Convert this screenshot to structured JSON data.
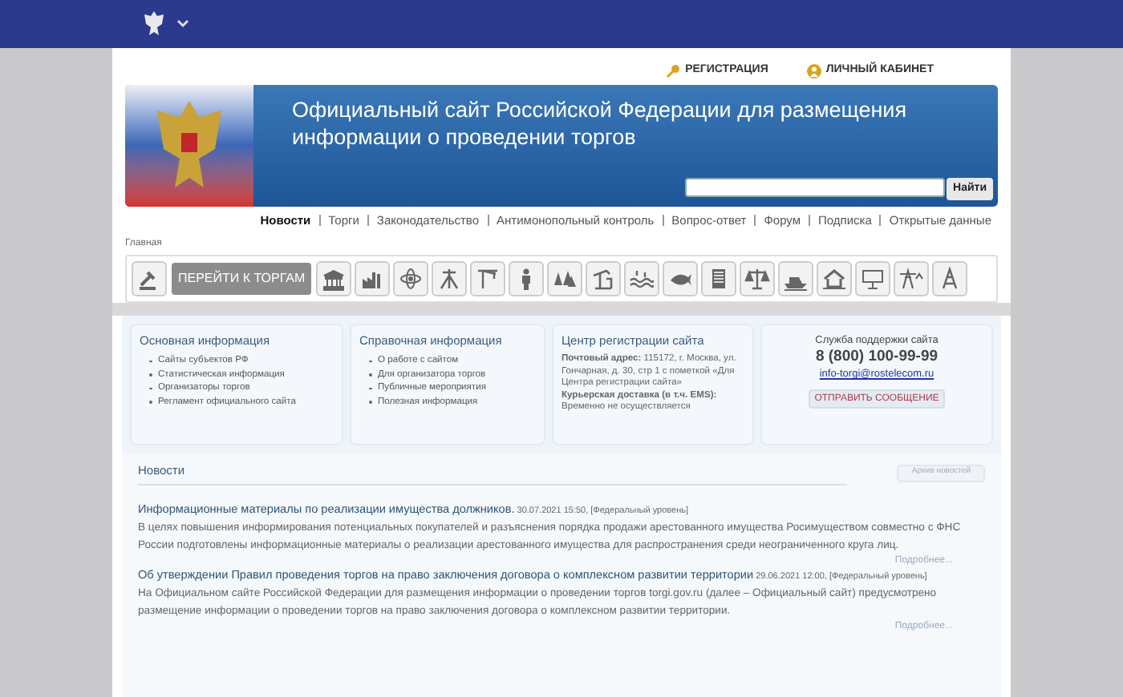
{
  "top_links": [
    {
      "label": "РЕГИСТРАЦИЯ",
      "kind": "key"
    },
    {
      "label": "ЛИЧНЫЙ КАБИНЕТ",
      "kind": "person"
    }
  ],
  "banner": {
    "title": "Официальный сайт Российской Федерации для размещения информации о проведении торгов",
    "search_button": "Найти"
  },
  "nav": [
    {
      "label": "Новости",
      "selected": true
    },
    {
      "label": "Торги",
      "selected": false
    },
    {
      "label": "Законодательство",
      "selected": false
    },
    {
      "label": "Антимонопольный контроль",
      "selected": false
    },
    {
      "label": "Вопрос-ответ",
      "selected": false
    },
    {
      "label": "Форум",
      "selected": false
    },
    {
      "label": "Подписка",
      "selected": false
    },
    {
      "label": "Открытые данные",
      "selected": false
    }
  ],
  "breadcrumb": "Главная",
  "go_button": "ПЕРЕЙТИ К ТОРГАМ",
  "panels": [
    {
      "kind": "list",
      "title": "Основная информация",
      "items": [
        "Сайты субъектов РФ",
        "Статистическая информация",
        "Организаторы торгов",
        "Регламент официального сайта"
      ]
    },
    {
      "kind": "list",
      "title": "Справочная информация",
      "items": [
        "О работе с сайтом",
        "Для организатора торгов",
        "Публичные мероприятия",
        "Полезная информация"
      ]
    },
    {
      "kind": "address",
      "title": "Центр регистрации сайта",
      "lines": [
        {
          "label": "Почтовый адрес:",
          "text": " 115172, г. Москва, ул. Гончарная, д. 30, стр 1 с пометкой «Для Центра регистрации сайта»"
        },
        {
          "label": "Курьерская доставка (в т.ч. EMS):",
          "text": " Временно не осуществляется"
        }
      ]
    },
    {
      "kind": "support",
      "title": "Служба поддержки сайта",
      "phone": "8 (800) 100-99-99",
      "email": "info-torgi@rostelecom.ru",
      "button": "ОТПРАВИТЬ СООБЩЕНИЕ"
    }
  ],
  "news": {
    "title": "Новости",
    "archive_button": "Архив новостей",
    "items": [
      {
        "headline": "Информационные материалы по реализации имущества должников.",
        "meta": "30.07.2021 15:50, [Федеральный уровень]",
        "body": "В целях повышения информирования потенциальных покупателей и разъяснения порядка продажи арестованного имущества Росимуществом совместно с ФНС России подготовлены информационные материалы о реализации арестованного имущества для распространения среди неограниченного круга лиц.",
        "more": "Подробнее..."
      },
      {
        "headline": "Об утверждении Правил проведения торгов на право заключения договора о комплексном развитии территории",
        "meta": "29.06.2021 12:00, [Федеральный уровень]",
        "body": "На Официальном сайте Российской Федерации для размещения информации о проведении торгов torgi.gov.ru (далее – Официальный сайт) предусмотрено размещение информации о проведении торгов на право заключения договора о комплексном развитии территории.",
        "more": "Подробнее..."
      }
    ]
  }
}
